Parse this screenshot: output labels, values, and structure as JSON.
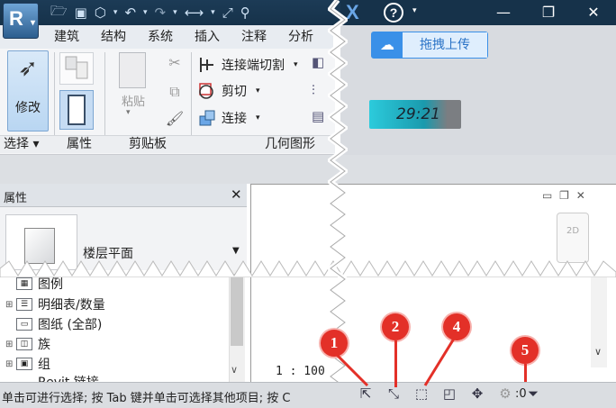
{
  "titlebar": {
    "app_logo": "R",
    "qat_icons": [
      "open-folder-icon",
      "save-icon",
      "sync-icon",
      "undo-icon",
      "redo-icon",
      "measure-icon",
      "dimension-icon",
      "tag-icon"
    ],
    "help": "?",
    "window_controls": [
      "—",
      "❐",
      "✕"
    ]
  },
  "menu": {
    "tabs": [
      "建筑",
      "结构",
      "系统",
      "插入",
      "注释",
      "分析"
    ]
  },
  "ribbon": {
    "modify_label": "修改",
    "paste_label": "粘贴",
    "geometry": {
      "items": [
        {
          "label": "连接端切割"
        },
        {
          "label": "剪切"
        },
        {
          "label": "连接"
        }
      ]
    },
    "panels": [
      "选择",
      "属性",
      "剪贴板",
      "几何图形"
    ],
    "panel_select_dropdown": "▾"
  },
  "upload": {
    "label": "拖拽上传"
  },
  "timer": {
    "value": "29:21"
  },
  "properties": {
    "title": "属性",
    "close": "✕",
    "type_label": "楼层平面"
  },
  "browser": {
    "items": [
      {
        "expand": "",
        "label": "图例"
      },
      {
        "expand": "⊞",
        "label": "明细表/数量"
      },
      {
        "expand": "",
        "label": "图纸 (全部)"
      },
      {
        "expand": "⊞",
        "label": "族"
      },
      {
        "expand": "⊞",
        "label": "组"
      },
      {
        "expand": "",
        "label": "Revit 链接"
      }
    ]
  },
  "canvas": {
    "scale": "1 : 100",
    "controls": "▭ ❐ ✕",
    "viewcube": "2D"
  },
  "status": {
    "text": "单击可进行选择; 按 Tab 键并单击可选择其他项目; 按 C",
    "filter_count": ":0"
  },
  "callouts": [
    "1",
    "2",
    "4",
    "5"
  ],
  "colors": {
    "callout": "#e33028",
    "titlebar": "#16324a",
    "upload": "#3a90e8"
  }
}
